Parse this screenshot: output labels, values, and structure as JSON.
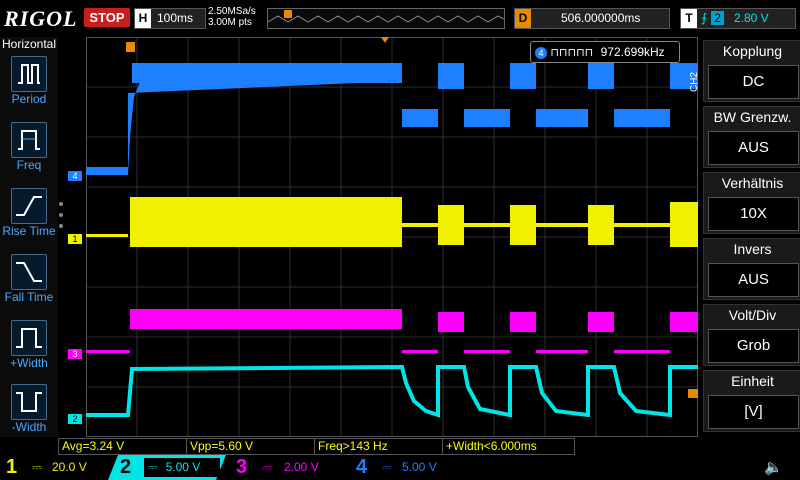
{
  "header": {
    "logo": "RIGOL",
    "run_state": "STOP",
    "timebase_key": "H",
    "timebase": "100ms",
    "sample_rate": "2.50MSa/s",
    "memory_depth": "3.00M pts",
    "delay_key": "D",
    "delay": "506.000000ms",
    "trigger_key": "T",
    "trigger_source": "2",
    "trigger_level": "2.80 V"
  },
  "left_menu": {
    "title": "Horizontal",
    "items": [
      {
        "label": "Period",
        "icon": "period-icon"
      },
      {
        "label": "Freq",
        "icon": "freq-icon"
      },
      {
        "label": "Rise Time",
        "icon": "rise-time-icon"
      },
      {
        "label": "Fall Time",
        "icon": "fall-time-icon"
      },
      {
        "label": "+Width",
        "icon": "pos-width-icon"
      },
      {
        "label": "-Width",
        "icon": "neg-width-icon"
      }
    ]
  },
  "counter": {
    "channel": "4",
    "value": "972.699kHz"
  },
  "right_menu": {
    "channel_tab": "CH2",
    "items": [
      {
        "title": "Kopplung",
        "value": "DC"
      },
      {
        "title": "BW Grenzw.",
        "value": "AUS"
      },
      {
        "title": "Verhältnis",
        "value": "10X"
      },
      {
        "title": "Invers",
        "value": "AUS"
      },
      {
        "title": "Volt/Div",
        "value": "Grob"
      },
      {
        "title": "Einheit",
        "value": "[V]"
      }
    ]
  },
  "measurements": [
    {
      "label": "Avg=3.24 V"
    },
    {
      "label": "Vpp=5.60 V"
    },
    {
      "label": "Freq>143 Hz"
    },
    {
      "label": "+Width<6.000ms"
    }
  ],
  "channels": [
    {
      "num": "1",
      "scale": "20.0 V",
      "color": "#f0f000"
    },
    {
      "num": "2",
      "scale": "5.00 V",
      "color": "#00e5e5"
    },
    {
      "num": "3",
      "scale": "2.00 V",
      "color": "#ff00ff"
    },
    {
      "num": "4",
      "scale": "5.00 V",
      "color": "#1e7fff"
    }
  ],
  "trace_markers": [
    "4",
    "1",
    "3",
    "2"
  ]
}
